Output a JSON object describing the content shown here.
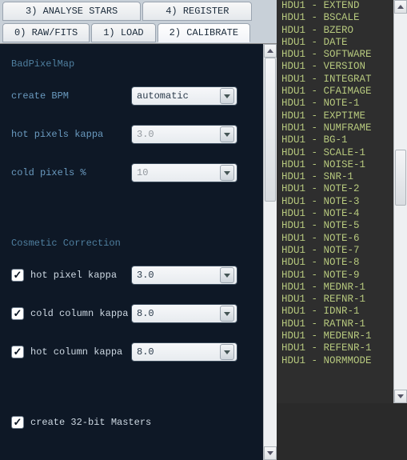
{
  "tabs": {
    "row1": [
      "3) ANALYSE STARS",
      "4) REGISTER"
    ],
    "row2": [
      "0) RAW/FITS",
      "1) LOAD",
      "2) CALIBRATE"
    ],
    "active": "2) CALIBRATE"
  },
  "bad_pixel_map": {
    "title": "BadPixelMap",
    "create_label": "create BPM",
    "create_value": "automatic",
    "hot_kappa_label": "hot pixels kappa",
    "hot_kappa_value": "3.0",
    "cold_pct_label": "cold pixels %",
    "cold_pct_value": "10"
  },
  "cosmetic": {
    "title": "Cosmetic Correction",
    "hot_pixel_label": "hot pixel kappa",
    "hot_pixel_value": "3.0",
    "cold_col_label": "cold column kappa",
    "cold_col_value": "8.0",
    "hot_col_label": "hot column kappa",
    "hot_col_value": "8.0"
  },
  "masters": {
    "label": "create 32-bit Masters"
  },
  "checkmark": "✓",
  "hdu": [
    "HDU1 - EXTEND",
    "HDU1 - BSCALE",
    "HDU1 - BZERO",
    "HDU1 - DATE",
    "HDU1 - SOFTWARE",
    "HDU1 - VERSION",
    "HDU1 - INTEGRAT",
    "HDU1 - CFAIMAGE",
    "HDU1 - NOTE-1",
    "HDU1 - EXPTIME",
    "HDU1 - NUMFRAME",
    "HDU1 - BG-1",
    "HDU1 - SCALE-1",
    "HDU1 - NOISE-1",
    "HDU1 - SNR-1",
    "HDU1 - NOTE-2",
    "HDU1 - NOTE-3",
    "HDU1 - NOTE-4",
    "HDU1 - NOTE-5",
    "HDU1 - NOTE-6",
    "HDU1 - NOTE-7",
    "HDU1 - NOTE-8",
    "HDU1 - NOTE-9",
    "HDU1 - MEDNR-1",
    "HDU1 - REFNR-1",
    "HDU1 - IDNR-1",
    "HDU1 - RATNR-1",
    "HDU1 - MEDENR-1",
    "HDU1 - REFENR-1",
    "HDU1 - NORMMODE"
  ]
}
